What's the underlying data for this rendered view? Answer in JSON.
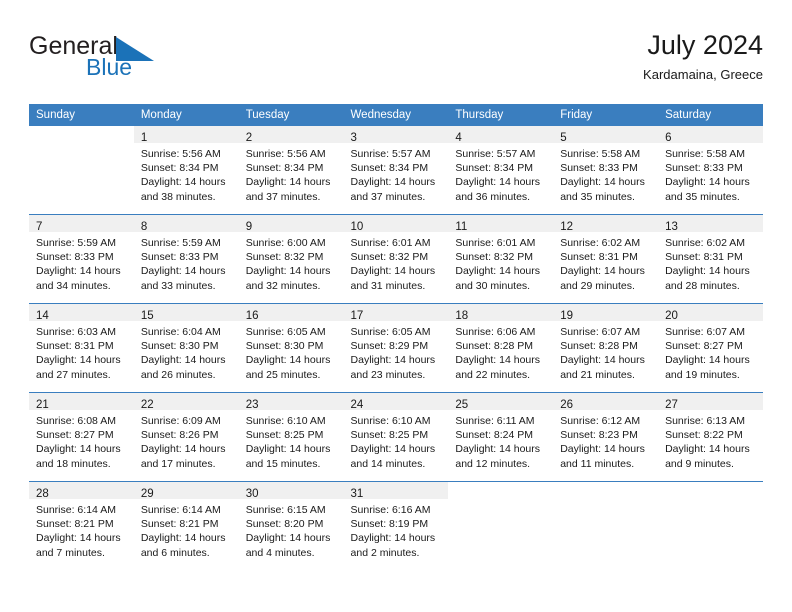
{
  "brand": {
    "name_top": "General",
    "name_bottom": "Blue",
    "triangle_color": "#1b72b8",
    "text_color": "#231f20"
  },
  "header": {
    "title": "July 2024",
    "location": "Kardamaina, Greece"
  },
  "theme": {
    "header_bg": "#3a7ebf",
    "header_text": "#ffffff",
    "daynum_band_bg": "#f0f0f0",
    "row_divider": "#3a7ebf",
    "body_text": "#1a1a1a"
  },
  "weekdays": [
    "Sunday",
    "Monday",
    "Tuesday",
    "Wednesday",
    "Thursday",
    "Friday",
    "Saturday"
  ],
  "weeks": [
    [
      {
        "day": "",
        "lines": []
      },
      {
        "day": "1",
        "lines": [
          "Sunrise: 5:56 AM",
          "Sunset: 8:34 PM",
          "Daylight: 14 hours",
          "and 38 minutes."
        ]
      },
      {
        "day": "2",
        "lines": [
          "Sunrise: 5:56 AM",
          "Sunset: 8:34 PM",
          "Daylight: 14 hours",
          "and 37 minutes."
        ]
      },
      {
        "day": "3",
        "lines": [
          "Sunrise: 5:57 AM",
          "Sunset: 8:34 PM",
          "Daylight: 14 hours",
          "and 37 minutes."
        ]
      },
      {
        "day": "4",
        "lines": [
          "Sunrise: 5:57 AM",
          "Sunset: 8:34 PM",
          "Daylight: 14 hours",
          "and 36 minutes."
        ]
      },
      {
        "day": "5",
        "lines": [
          "Sunrise: 5:58 AM",
          "Sunset: 8:33 PM",
          "Daylight: 14 hours",
          "and 35 minutes."
        ]
      },
      {
        "day": "6",
        "lines": [
          "Sunrise: 5:58 AM",
          "Sunset: 8:33 PM",
          "Daylight: 14 hours",
          "and 35 minutes."
        ]
      }
    ],
    [
      {
        "day": "7",
        "lines": [
          "Sunrise: 5:59 AM",
          "Sunset: 8:33 PM",
          "Daylight: 14 hours",
          "and 34 minutes."
        ]
      },
      {
        "day": "8",
        "lines": [
          "Sunrise: 5:59 AM",
          "Sunset: 8:33 PM",
          "Daylight: 14 hours",
          "and 33 minutes."
        ]
      },
      {
        "day": "9",
        "lines": [
          "Sunrise: 6:00 AM",
          "Sunset: 8:32 PM",
          "Daylight: 14 hours",
          "and 32 minutes."
        ]
      },
      {
        "day": "10",
        "lines": [
          "Sunrise: 6:01 AM",
          "Sunset: 8:32 PM",
          "Daylight: 14 hours",
          "and 31 minutes."
        ]
      },
      {
        "day": "11",
        "lines": [
          "Sunrise: 6:01 AM",
          "Sunset: 8:32 PM",
          "Daylight: 14 hours",
          "and 30 minutes."
        ]
      },
      {
        "day": "12",
        "lines": [
          "Sunrise: 6:02 AM",
          "Sunset: 8:31 PM",
          "Daylight: 14 hours",
          "and 29 minutes."
        ]
      },
      {
        "day": "13",
        "lines": [
          "Sunrise: 6:02 AM",
          "Sunset: 8:31 PM",
          "Daylight: 14 hours",
          "and 28 minutes."
        ]
      }
    ],
    [
      {
        "day": "14",
        "lines": [
          "Sunrise: 6:03 AM",
          "Sunset: 8:31 PM",
          "Daylight: 14 hours",
          "and 27 minutes."
        ]
      },
      {
        "day": "15",
        "lines": [
          "Sunrise: 6:04 AM",
          "Sunset: 8:30 PM",
          "Daylight: 14 hours",
          "and 26 minutes."
        ]
      },
      {
        "day": "16",
        "lines": [
          "Sunrise: 6:05 AM",
          "Sunset: 8:30 PM",
          "Daylight: 14 hours",
          "and 25 minutes."
        ]
      },
      {
        "day": "17",
        "lines": [
          "Sunrise: 6:05 AM",
          "Sunset: 8:29 PM",
          "Daylight: 14 hours",
          "and 23 minutes."
        ]
      },
      {
        "day": "18",
        "lines": [
          "Sunrise: 6:06 AM",
          "Sunset: 8:28 PM",
          "Daylight: 14 hours",
          "and 22 minutes."
        ]
      },
      {
        "day": "19",
        "lines": [
          "Sunrise: 6:07 AM",
          "Sunset: 8:28 PM",
          "Daylight: 14 hours",
          "and 21 minutes."
        ]
      },
      {
        "day": "20",
        "lines": [
          "Sunrise: 6:07 AM",
          "Sunset: 8:27 PM",
          "Daylight: 14 hours",
          "and 19 minutes."
        ]
      }
    ],
    [
      {
        "day": "21",
        "lines": [
          "Sunrise: 6:08 AM",
          "Sunset: 8:27 PM",
          "Daylight: 14 hours",
          "and 18 minutes."
        ]
      },
      {
        "day": "22",
        "lines": [
          "Sunrise: 6:09 AM",
          "Sunset: 8:26 PM",
          "Daylight: 14 hours",
          "and 17 minutes."
        ]
      },
      {
        "day": "23",
        "lines": [
          "Sunrise: 6:10 AM",
          "Sunset: 8:25 PM",
          "Daylight: 14 hours",
          "and 15 minutes."
        ]
      },
      {
        "day": "24",
        "lines": [
          "Sunrise: 6:10 AM",
          "Sunset: 8:25 PM",
          "Daylight: 14 hours",
          "and 14 minutes."
        ]
      },
      {
        "day": "25",
        "lines": [
          "Sunrise: 6:11 AM",
          "Sunset: 8:24 PM",
          "Daylight: 14 hours",
          "and 12 minutes."
        ]
      },
      {
        "day": "26",
        "lines": [
          "Sunrise: 6:12 AM",
          "Sunset: 8:23 PM",
          "Daylight: 14 hours",
          "and 11 minutes."
        ]
      },
      {
        "day": "27",
        "lines": [
          "Sunrise: 6:13 AM",
          "Sunset: 8:22 PM",
          "Daylight: 14 hours",
          "and 9 minutes."
        ]
      }
    ],
    [
      {
        "day": "28",
        "lines": [
          "Sunrise: 6:14 AM",
          "Sunset: 8:21 PM",
          "Daylight: 14 hours",
          "and 7 minutes."
        ]
      },
      {
        "day": "29",
        "lines": [
          "Sunrise: 6:14 AM",
          "Sunset: 8:21 PM",
          "Daylight: 14 hours",
          "and 6 minutes."
        ]
      },
      {
        "day": "30",
        "lines": [
          "Sunrise: 6:15 AM",
          "Sunset: 8:20 PM",
          "Daylight: 14 hours",
          "and 4 minutes."
        ]
      },
      {
        "day": "31",
        "lines": [
          "Sunrise: 6:16 AM",
          "Sunset: 8:19 PM",
          "Daylight: 14 hours",
          "and 2 minutes."
        ]
      },
      {
        "day": "",
        "lines": []
      },
      {
        "day": "",
        "lines": []
      },
      {
        "day": "",
        "lines": []
      }
    ]
  ]
}
